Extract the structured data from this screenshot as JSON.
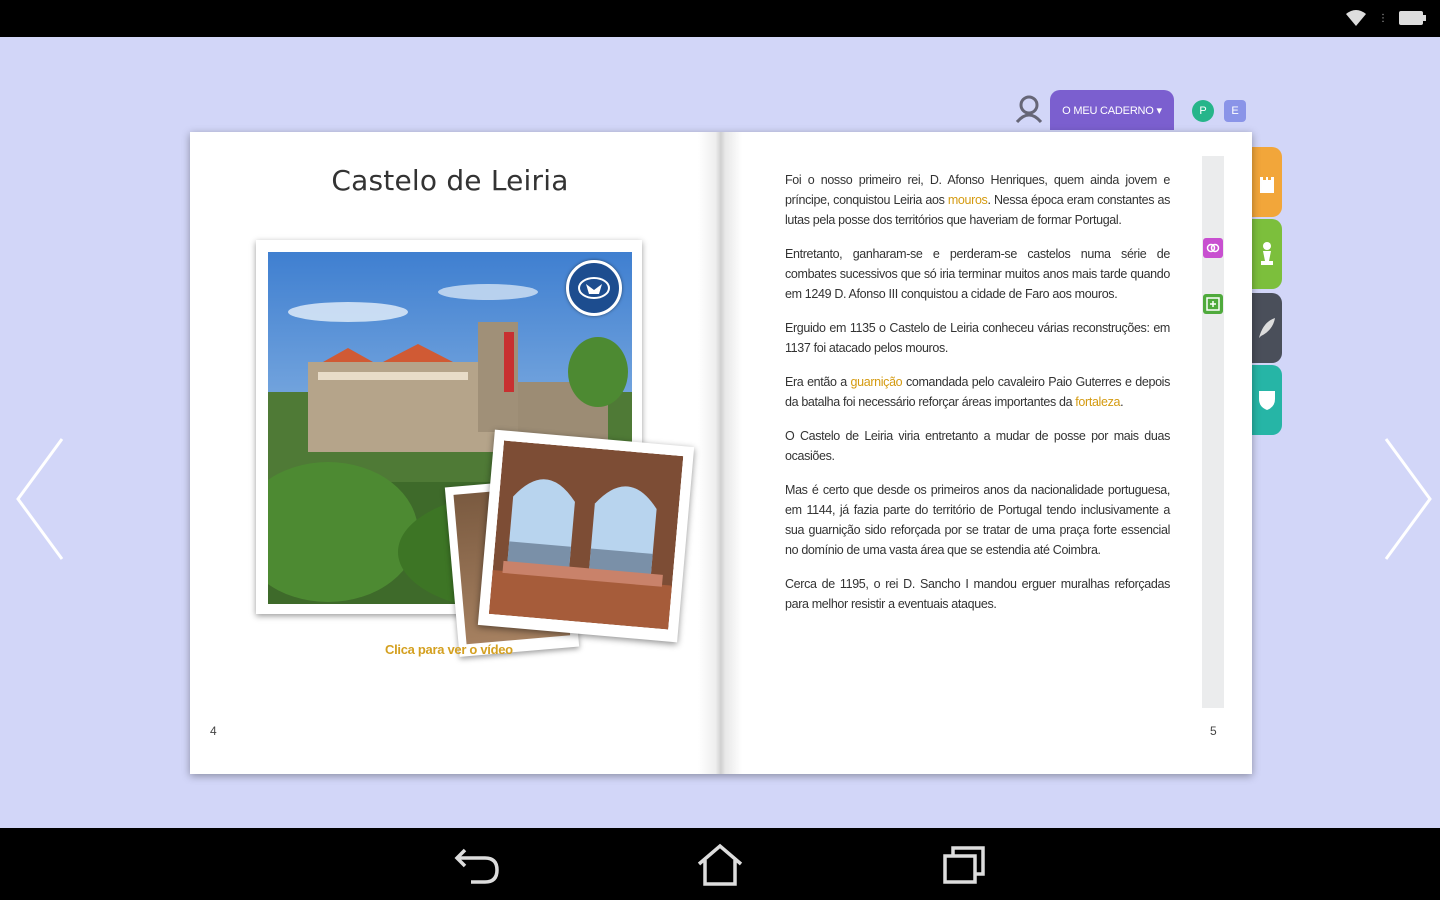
{
  "header": {
    "notebook_label": "O MEU CADERNO ▾",
    "circle_label": "P",
    "square_label": "E"
  },
  "left_page": {
    "title": "Castelo de Leiria",
    "caption": "Clica para ver o vídeo",
    "page_number": "4"
  },
  "right_page": {
    "page_number": "5",
    "paragraphs": [
      {
        "before": "Foi o nosso primeiro rei, D. Afonso Henriques, quem ainda jovem e príncipe, conquistou Leiria aos ",
        "link": "mouros",
        "after": ". Nessa época eram constantes as lutas pela posse dos territórios que haveriam de formar Portugal."
      },
      {
        "before": "Entretanto, ganharam-se e perderam-se castelos numa série de combates sucessivos que só iria terminar muitos anos mais tarde quando em 1249 D. Afonso III conquistou a cidade de Faro aos mouros.",
        "link": "",
        "after": ""
      },
      {
        "before": "Erguido em 1135 o Castelo de Leiria conheceu várias reconstruções: em 1137 foi atacado pelos mouros.",
        "link": "",
        "after": ""
      },
      {
        "before": "Era então a ",
        "link": "guarnição",
        "after": " comandada pelo cavaleiro Paio Guterres e depois da batalha foi necessário reforçar áreas importantes da ",
        "link2": "fortaleza",
        "after2": "."
      },
      {
        "before": "O Castelo de Leiria viria entretanto a mudar de posse por mais duas ocasiões.",
        "link": "",
        "after": ""
      },
      {
        "before": "Mas é certo que desde os primeiros anos da nacionalidade portuguesa, em 1144, já fazia parte do território de Portugal tendo inclusivamente a sua guarnição sido reforçada por se tratar de uma praça forte essencial no domínio de uma vasta área que se estendia até Coimbra.",
        "link": "",
        "after": ""
      },
      {
        "before": "Cerca de 1195, o rei D. Sancho I mandou erguer muralhas reforçadas para melhor resistir a eventuais ataques.",
        "link": "",
        "after": ""
      }
    ]
  },
  "colors": {
    "background": "#d2d6f8",
    "notebook_tab": "#7b5fcf",
    "highlight": "#d49a10",
    "tab_orange": "#f2a63a",
    "tab_green": "#7cbf3c",
    "tab_dark": "#4a4f5a",
    "tab_teal": "#26b5a6"
  },
  "icons": {
    "nav_back": "back-arrow-icon",
    "nav_home": "home-icon",
    "nav_recent": "recent-apps-icon",
    "prev_page": "chevron-left-icon",
    "next_page": "chevron-right-icon",
    "user": "user-icon",
    "video": "video-badge-icon",
    "tab_castle": "castle-icon",
    "tab_chess": "chess-piece-icon",
    "tab_feather": "feather-icon",
    "tab_shield": "shield-icon",
    "link": "link-icon",
    "note": "note-add-icon",
    "wifi": "wifi-icon",
    "battery": "battery-icon"
  }
}
